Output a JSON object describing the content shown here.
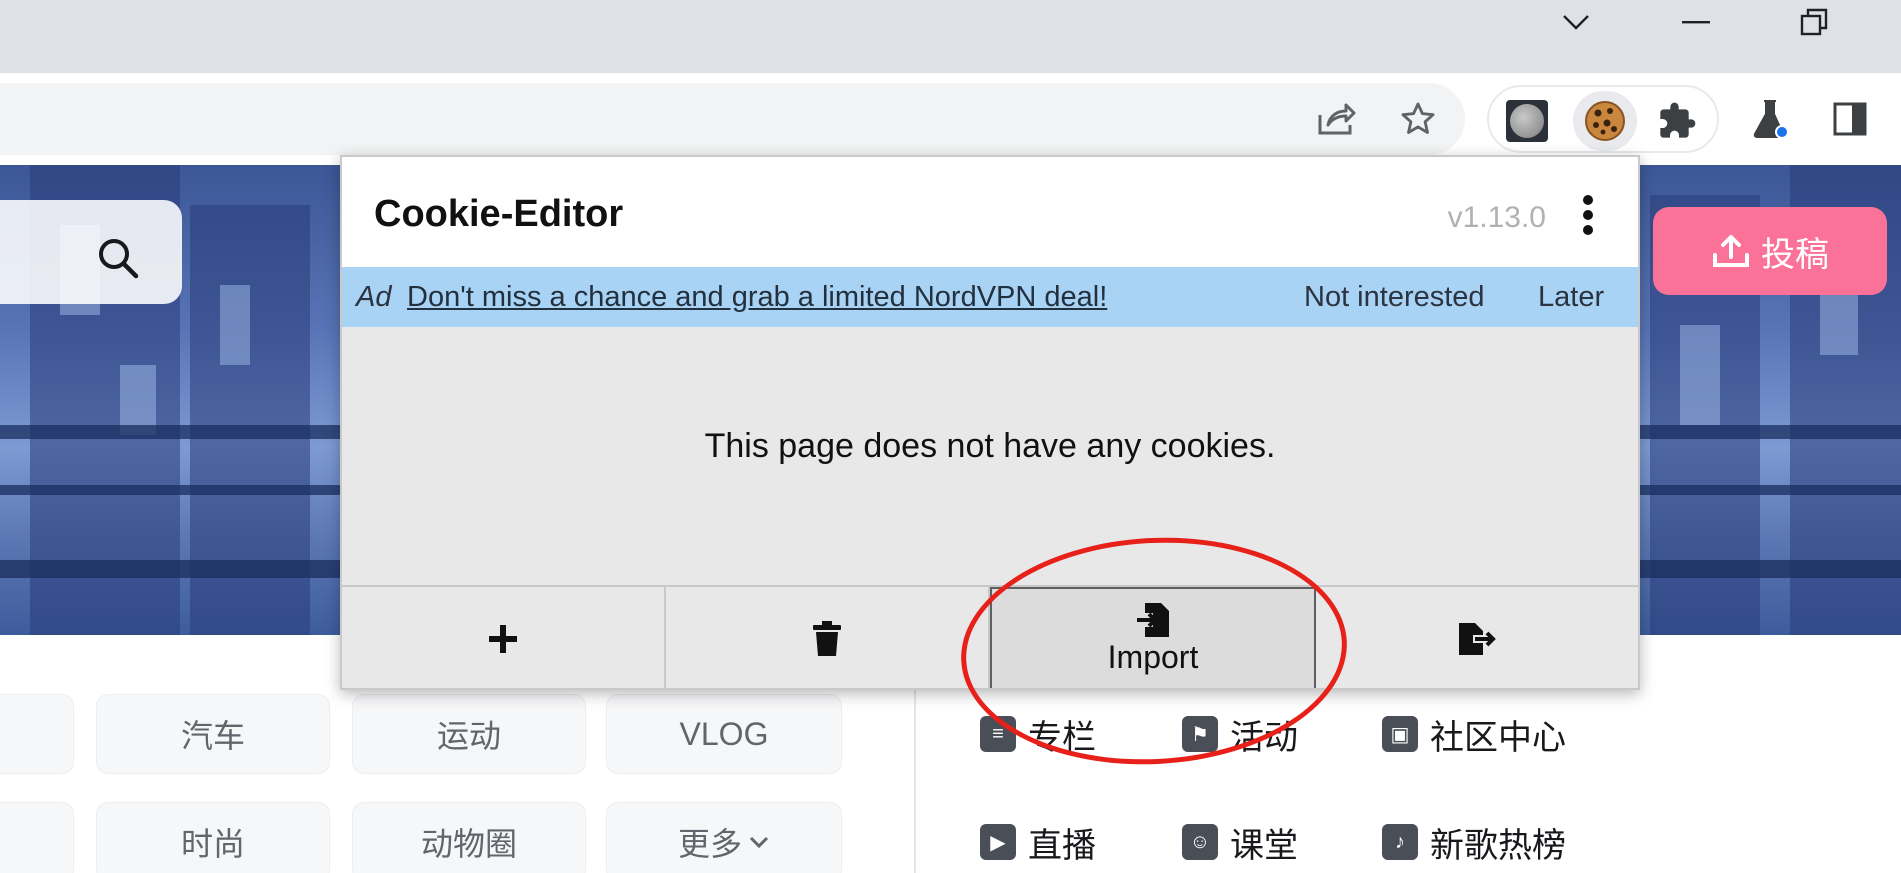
{
  "browser": {
    "window_controls": {
      "tab_search": "tab-search",
      "minimize": "minimize",
      "restore": "restore"
    }
  },
  "page": {
    "upload_label": "投稿",
    "chips_row1": [
      "汽车",
      "运动",
      "VLOG"
    ],
    "chips_row2": [
      "时尚",
      "动物圈",
      "更多"
    ],
    "side_links_row1": [
      "专栏",
      "活动",
      "社区中心"
    ],
    "side_links_row2": [
      "直播",
      "课堂",
      "新歌热榜"
    ]
  },
  "popup": {
    "title": "Cookie-Editor",
    "version": "v1.13.0",
    "ad": {
      "tag": "Ad",
      "link_text": "Don't miss a chance and grab a limited NordVPN deal!",
      "not_interested": "Not interested",
      "later": "Later"
    },
    "empty_message": "This page does not have any cookies.",
    "footer": {
      "import_label": "Import"
    }
  },
  "colors": {
    "accent_pink": "#fb7299",
    "ad_bar": "#a9d3f5",
    "annotation": "#e8201a"
  }
}
